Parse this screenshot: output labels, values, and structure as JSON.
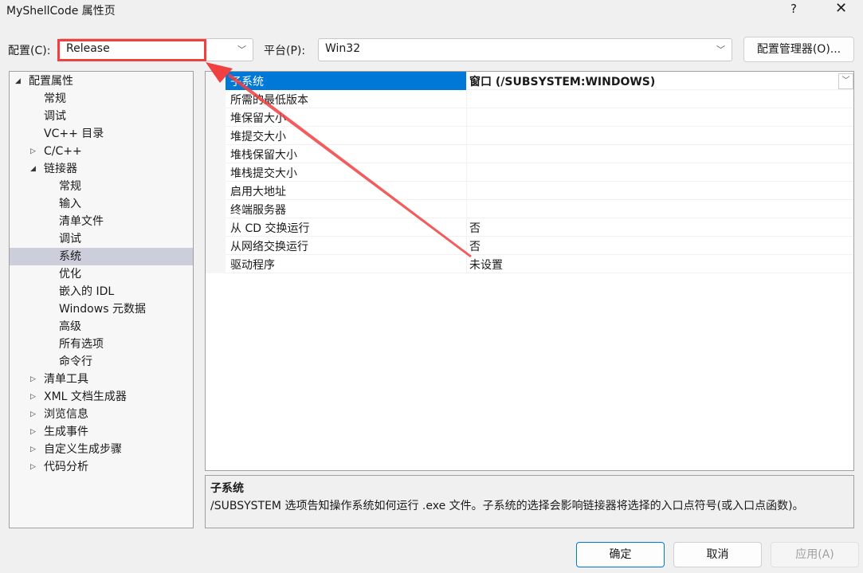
{
  "window": {
    "title": "MyShellCode 属性页",
    "help": "?",
    "close": "✕"
  },
  "config": {
    "label": "配置(C):",
    "value": "Release",
    "platform_label": "平台(P):",
    "platform_value": "Win32",
    "manager_button": "配置管理器(O)..."
  },
  "tree": [
    {
      "label": "配置属性",
      "level": 0,
      "toggle": "expanded"
    },
    {
      "label": "常规",
      "level": 1
    },
    {
      "label": "调试",
      "level": 1
    },
    {
      "label": "VC++ 目录",
      "level": 1
    },
    {
      "label": "C/C++",
      "level": 1,
      "toggle": "collapsed"
    },
    {
      "label": "链接器",
      "level": 1,
      "toggle": "expanded"
    },
    {
      "label": "常规",
      "level": 2
    },
    {
      "label": "输入",
      "level": 2
    },
    {
      "label": "清单文件",
      "level": 2
    },
    {
      "label": "调试",
      "level": 2
    },
    {
      "label": "系统",
      "level": 2,
      "selected": true
    },
    {
      "label": "优化",
      "level": 2
    },
    {
      "label": "嵌入的 IDL",
      "level": 2
    },
    {
      "label": "Windows 元数据",
      "level": 2
    },
    {
      "label": "高级",
      "level": 2
    },
    {
      "label": "所有选项",
      "level": 2
    },
    {
      "label": "命令行",
      "level": 2
    },
    {
      "label": "清单工具",
      "level": 1,
      "toggle": "collapsed"
    },
    {
      "label": "XML 文档生成器",
      "level": 1,
      "toggle": "collapsed"
    },
    {
      "label": "浏览信息",
      "level": 1,
      "toggle": "collapsed"
    },
    {
      "label": "生成事件",
      "level": 1,
      "toggle": "collapsed"
    },
    {
      "label": "自定义生成步骤",
      "level": 1,
      "toggle": "collapsed"
    },
    {
      "label": "代码分析",
      "level": 1,
      "toggle": "collapsed"
    }
  ],
  "properties": [
    {
      "name": "子系统",
      "value": "窗口 (/SUBSYSTEM:WINDOWS)",
      "selected": true
    },
    {
      "name": "所需的最低版本",
      "value": ""
    },
    {
      "name": "堆保留大小",
      "value": ""
    },
    {
      "name": "堆提交大小",
      "value": ""
    },
    {
      "name": "堆栈保留大小",
      "value": ""
    },
    {
      "name": "堆栈提交大小",
      "value": ""
    },
    {
      "name": "启用大地址",
      "value": ""
    },
    {
      "name": "终端服务器",
      "value": ""
    },
    {
      "name": "从 CD 交换运行",
      "value": "否"
    },
    {
      "name": "从网络交换运行",
      "value": "否"
    },
    {
      "name": "驱动程序",
      "value": "未设置"
    }
  ],
  "description": {
    "title": "子系统",
    "text": "/SUBSYSTEM 选项告知操作系统如何运行 .exe 文件。子系统的选择会影响链接器将选择的入口点符号(或入口点函数)。"
  },
  "buttons": {
    "ok": "确定",
    "cancel": "取消",
    "apply": "应用(A)"
  },
  "annotation_color": "#f04040",
  "selection_color": "#0078d7"
}
